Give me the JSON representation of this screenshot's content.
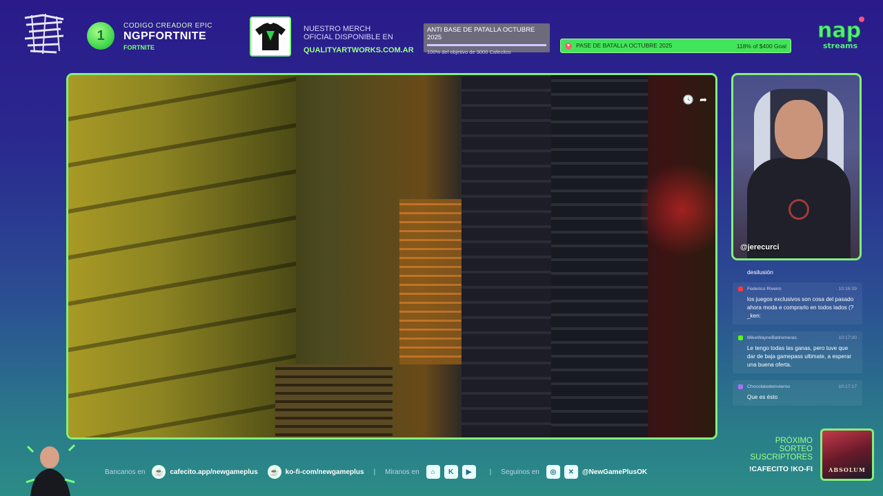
{
  "creator": {
    "line1": "CODIGO CREADOR EPIC",
    "name": "NGPFORTNITE",
    "game": "FORTNITE",
    "coin_icon": "1"
  },
  "merch": {
    "line1": "NUESTRO MERCH",
    "line2": "OFICIAL DISPONIBLE EN",
    "url": "QUALITYARTWORKS.COM.AR"
  },
  "goal_cafecito": {
    "title": "ANTI BASE DE PATALLA OCTUBRE 2025",
    "subtitle": "100% del objetivo de 3000 Cafecitos",
    "progress": 1.0
  },
  "goal_kofi": {
    "title": "PASE DE BATALLA OCTUBRE 2025",
    "progress_text": "118% of $400 Goal",
    "progress": 1.18
  },
  "brand": {
    "logo_text": "nap",
    "logo_sub": "streams"
  },
  "game": {
    "icons": [
      "clock-icon",
      "share-icon"
    ],
    "clock_glyph": "🕓",
    "share_glyph": "➦"
  },
  "webcam": {
    "handle": "@jerecurci"
  },
  "chat": {
    "first_line": "desilusión",
    "messages": [
      {
        "user": "Federico Riveiro",
        "time": "10:16:39",
        "platform": "youtube",
        "badge_color": "#ff3b3b",
        "text": "los juegos exclusivos son cosa del pasado ahora moda e comprarlo en todos lados (?_ken:"
      },
      {
        "user": "MikeWayneBatiremeras",
        "time": "10:17:00",
        "platform": "kick",
        "badge_color": "#53fc18",
        "text": "Le tengo todas las ganas, pero tuve que dar de baja gamepass ultimate, a esperar una buena oferta."
      },
      {
        "user": "Chocolatedeinvierno",
        "time": "10:17:17",
        "platform": "twitch",
        "badge_color": "#a970ff",
        "text": "Que es ésto"
      }
    ]
  },
  "bottom": {
    "bancanos_label": "Bancanos en",
    "cafecito_url": "cafecito.app/newgameplus",
    "kofi_url": "ko-fi-com/newgameplus",
    "miranos_label": "Miranos en",
    "seguinos_label": "Seguinos en",
    "social_handle": "@NewGamePlusOK",
    "separator": "|"
  },
  "sorteo": {
    "line1": "PRÓXIMO",
    "line2": "SORTEO",
    "line3": "SUSCRIPTORES",
    "commands": "!CAFECITO  !KO-FI",
    "poster_title": "ABSOLUM"
  },
  "colors": {
    "accent_green": "#83f07a",
    "bg_top": "#2a1a8a",
    "bg_bottom": "#2b8c86"
  }
}
